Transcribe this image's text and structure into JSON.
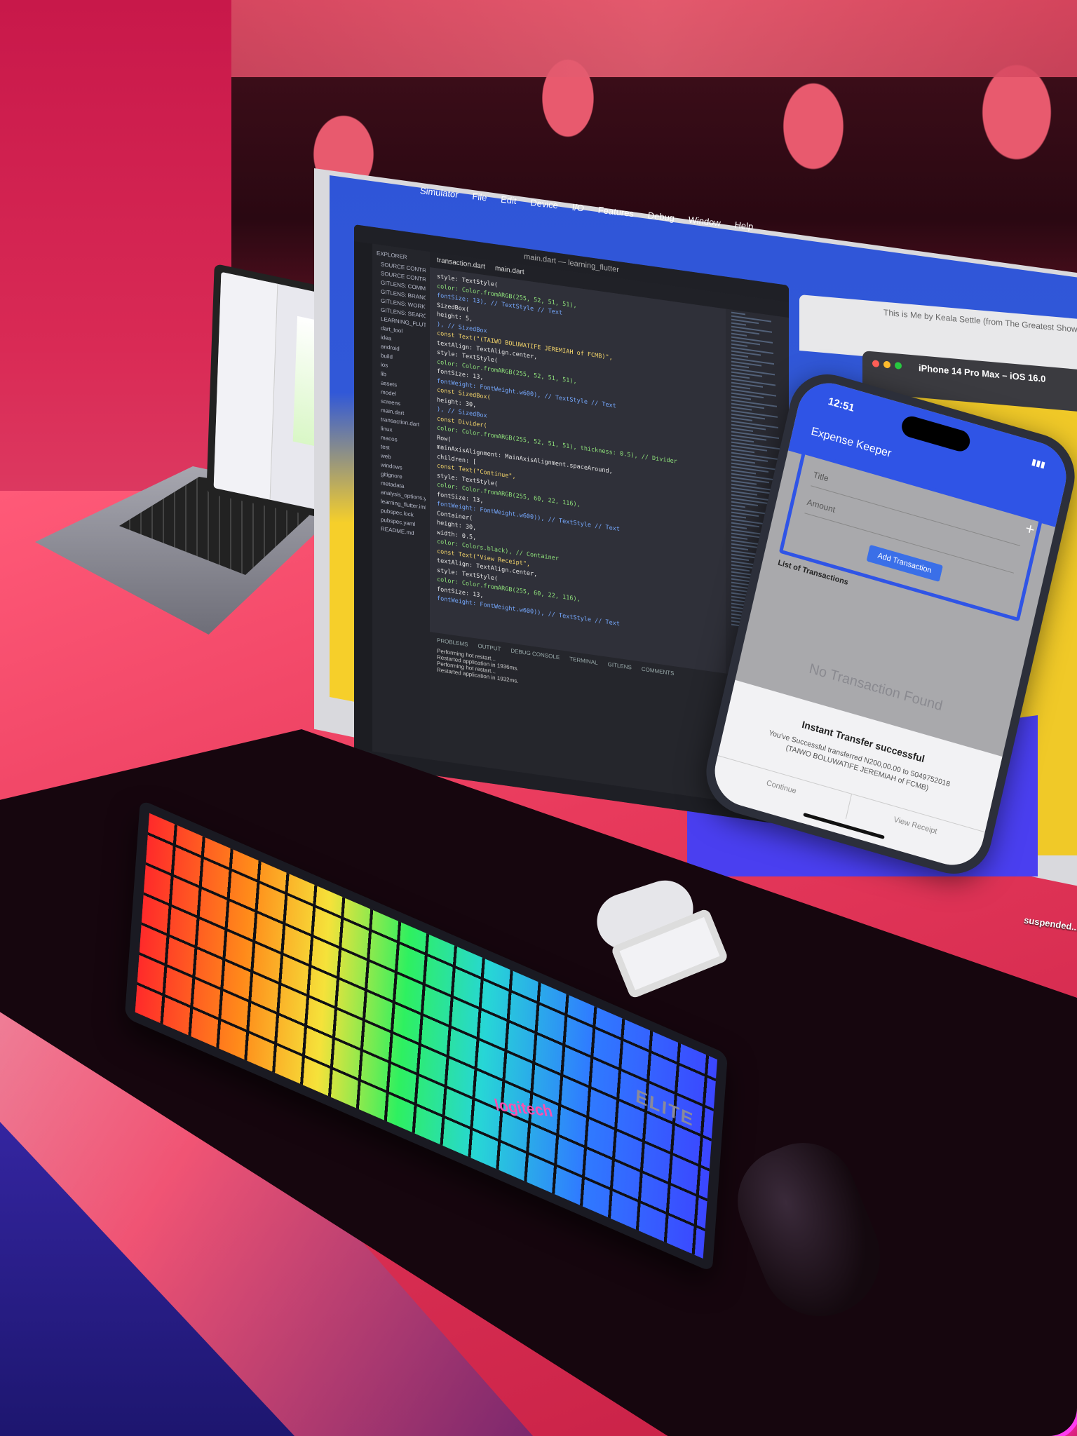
{
  "simulator_menu": [
    "Simulator",
    "File",
    "Edit",
    "Device",
    "I/O",
    "Features",
    "Debug",
    "Window",
    "Help"
  ],
  "vscode": {
    "window_title": "main.dart — learning_flutter",
    "explorer_label": "EXPLORER",
    "sidebar_items": [
      "SOURCE CONTROL REPOSITORIES",
      "SOURCE CONTROL",
      "GITLENS: COMMITS",
      "GITLENS: BRANCHES",
      "GITLENS: WORKTREES",
      "GITLENS: SEARCH & COMPARE",
      "LEARNING_FLUTTER",
      "dart_tool",
      "idea",
      "android",
      "build",
      "ios",
      "lib",
      "assets",
      "model",
      "screens",
      "main.dart",
      "transaction.dart",
      "linux",
      "macos",
      "test",
      "web",
      "windows",
      "gitignore",
      "metadata",
      "analysis_options.yaml",
      "learning_flutter.iml",
      "pubspec.lock",
      "pubspec.yaml",
      "README.md"
    ],
    "tabs": [
      "transaction.dart",
      "main.dart"
    ],
    "code_lines": [
      "style: TextStyle(",
      "  color: Color.fromARGB(255, 52, 51, 51),",
      "  fontSize: 13), // TextStyle // Text",
      "SizedBox(",
      "  height: 5,",
      "), // SizedBox",
      "const Text(\"(TAIWO BOLUWATIFE JEREMIAH of FCMB)\",",
      "  textAlign: TextAlign.center,",
      "  style: TextStyle(",
      "    color: Color.fromARGB(255, 52, 51, 51),",
      "    fontSize: 13,",
      "    fontWeight: FontWeight.w600), // TextStyle // Text",
      "const SizedBox(",
      "  height: 30,",
      "), // SizedBox",
      "const Divider(",
      "  color: Color.fromARGB(255, 52, 51, 51), thickness: 0.5), // Divider",
      "Row(",
      "  mainAxisAlignment: MainAxisAlignment.spaceAround,",
      "  children: [",
      "    const Text(\"Continue\",",
      "      style: TextStyle(",
      "        color: Color.fromARGB(255, 60, 22, 116),",
      "        fontSize: 13,",
      "        fontWeight: FontWeight.w600)), // TextStyle // Text",
      "    Container(",
      "      height: 30,",
      "      width: 0.5,",
      "      color: Colors.black), // Container",
      "    const Text(\"View Receipt\",",
      "      textAlign: TextAlign.center,",
      "      style: TextStyle(",
      "        color: Color.fromARGB(255, 60, 22, 116),",
      "        fontSize: 13,",
      "        fontWeight: FontWeight.w600)), // TextStyle // Text"
    ],
    "panel_tabs": [
      "PROBLEMS",
      "OUTPUT",
      "DEBUG CONSOLE",
      "TERMINAL",
      "GITLENS",
      "COMMENTS"
    ],
    "panel_lines": [
      "Performing hot restart...",
      "Restarted application in 1936ms.",
      "Performing hot restart...",
      "Restarted application in 1932ms."
    ]
  },
  "browser": {
    "title": "This is Me by Keala Settle (from The Greatest Showman)"
  },
  "simulator": {
    "title": "iPhone 14 Pro Max – iOS 16.0"
  },
  "phone": {
    "time": "12:51",
    "app_title": "Expense Keeper",
    "add_icon_text": "+",
    "title_placeholder": "Title",
    "amount_placeholder": "Amount",
    "add_button": "Add Transaction",
    "list_header": "List of Transactions",
    "empty_text": "No Transaction Found",
    "sheet_title": "Instant Transfer successful",
    "sheet_message": "You've Successful transferred N200,00.00 to 5049752018",
    "sheet_recipient": "(TAIWO BOLUWATIFE JEREMIAH of FCMB)",
    "continue_label": "Continue",
    "receipt_label": "View Receipt"
  },
  "desktop": {
    "file_label": "suspended..."
  },
  "keyboard": {
    "logo": "logitech",
    "brand": "ELITE"
  },
  "colors": {
    "phone_blue": "#2f54e6",
    "button_blue": "#3a6fe8",
    "mousepad_glow": "#ff3df0"
  }
}
